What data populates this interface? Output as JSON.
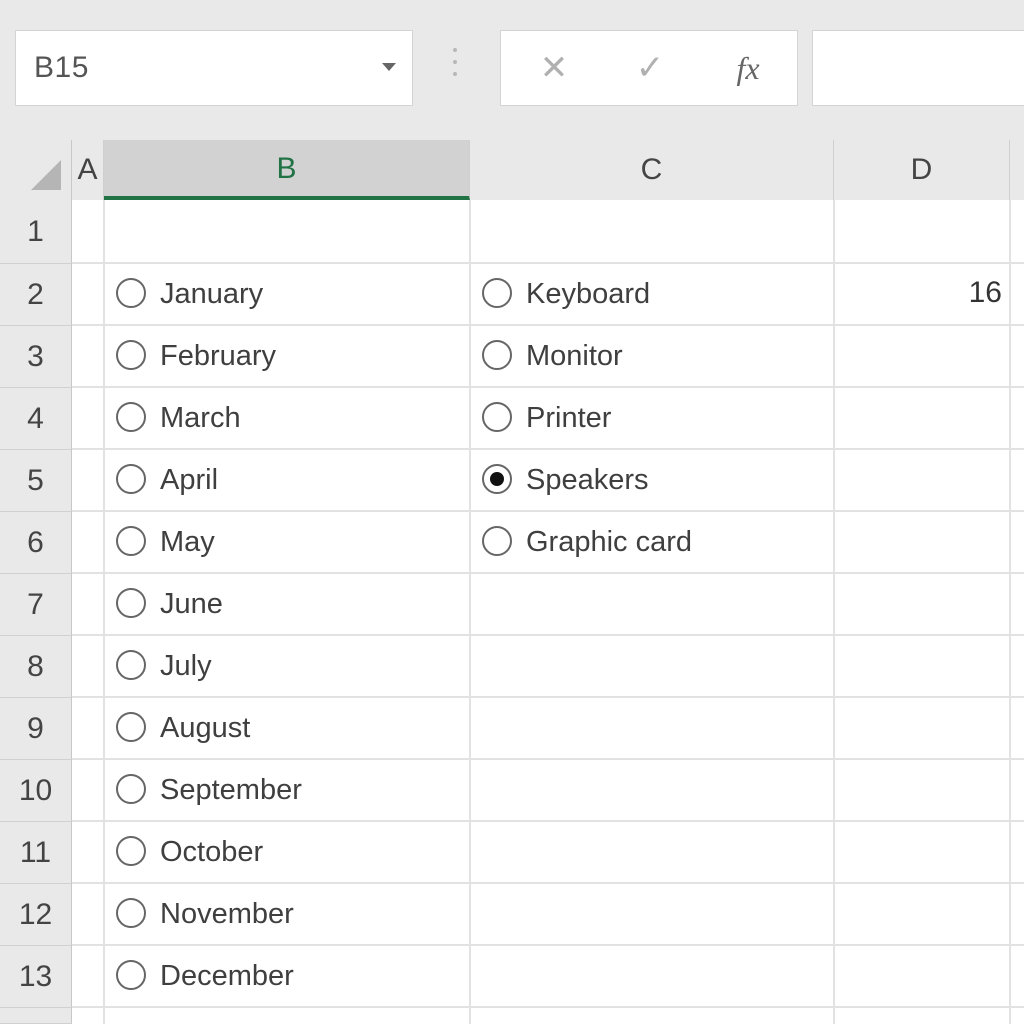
{
  "formula_bar": {
    "name_box": "B15",
    "cancel_symbol": "✕",
    "enter_symbol": "✓",
    "fx_label": "fx",
    "formula": ""
  },
  "columns": [
    "A",
    "B",
    "C",
    "D"
  ],
  "selected_column": "B",
  "rows": [
    "1",
    "2",
    "3",
    "4",
    "5",
    "6",
    "7",
    "8",
    "9",
    "10",
    "11",
    "12",
    "13"
  ],
  "months": [
    {
      "label": "January",
      "selected": false
    },
    {
      "label": "February",
      "selected": false
    },
    {
      "label": "March",
      "selected": false
    },
    {
      "label": "April",
      "selected": false
    },
    {
      "label": "May",
      "selected": false
    },
    {
      "label": "June",
      "selected": false
    },
    {
      "label": "July",
      "selected": false
    },
    {
      "label": "August",
      "selected": false
    },
    {
      "label": "September",
      "selected": false
    },
    {
      "label": "October",
      "selected": false
    },
    {
      "label": "November",
      "selected": false
    },
    {
      "label": "December",
      "selected": false
    }
  ],
  "products": [
    {
      "label": "Keyboard",
      "selected": false
    },
    {
      "label": "Monitor",
      "selected": false
    },
    {
      "label": "Printer",
      "selected": false
    },
    {
      "label": "Speakers",
      "selected": true
    },
    {
      "label": "Graphic card",
      "selected": false
    }
  ],
  "cells": {
    "D2": "16"
  },
  "colors": {
    "accent": "#217346",
    "grid": "#e2e2e2",
    "header_bg": "#e9e9e9"
  }
}
